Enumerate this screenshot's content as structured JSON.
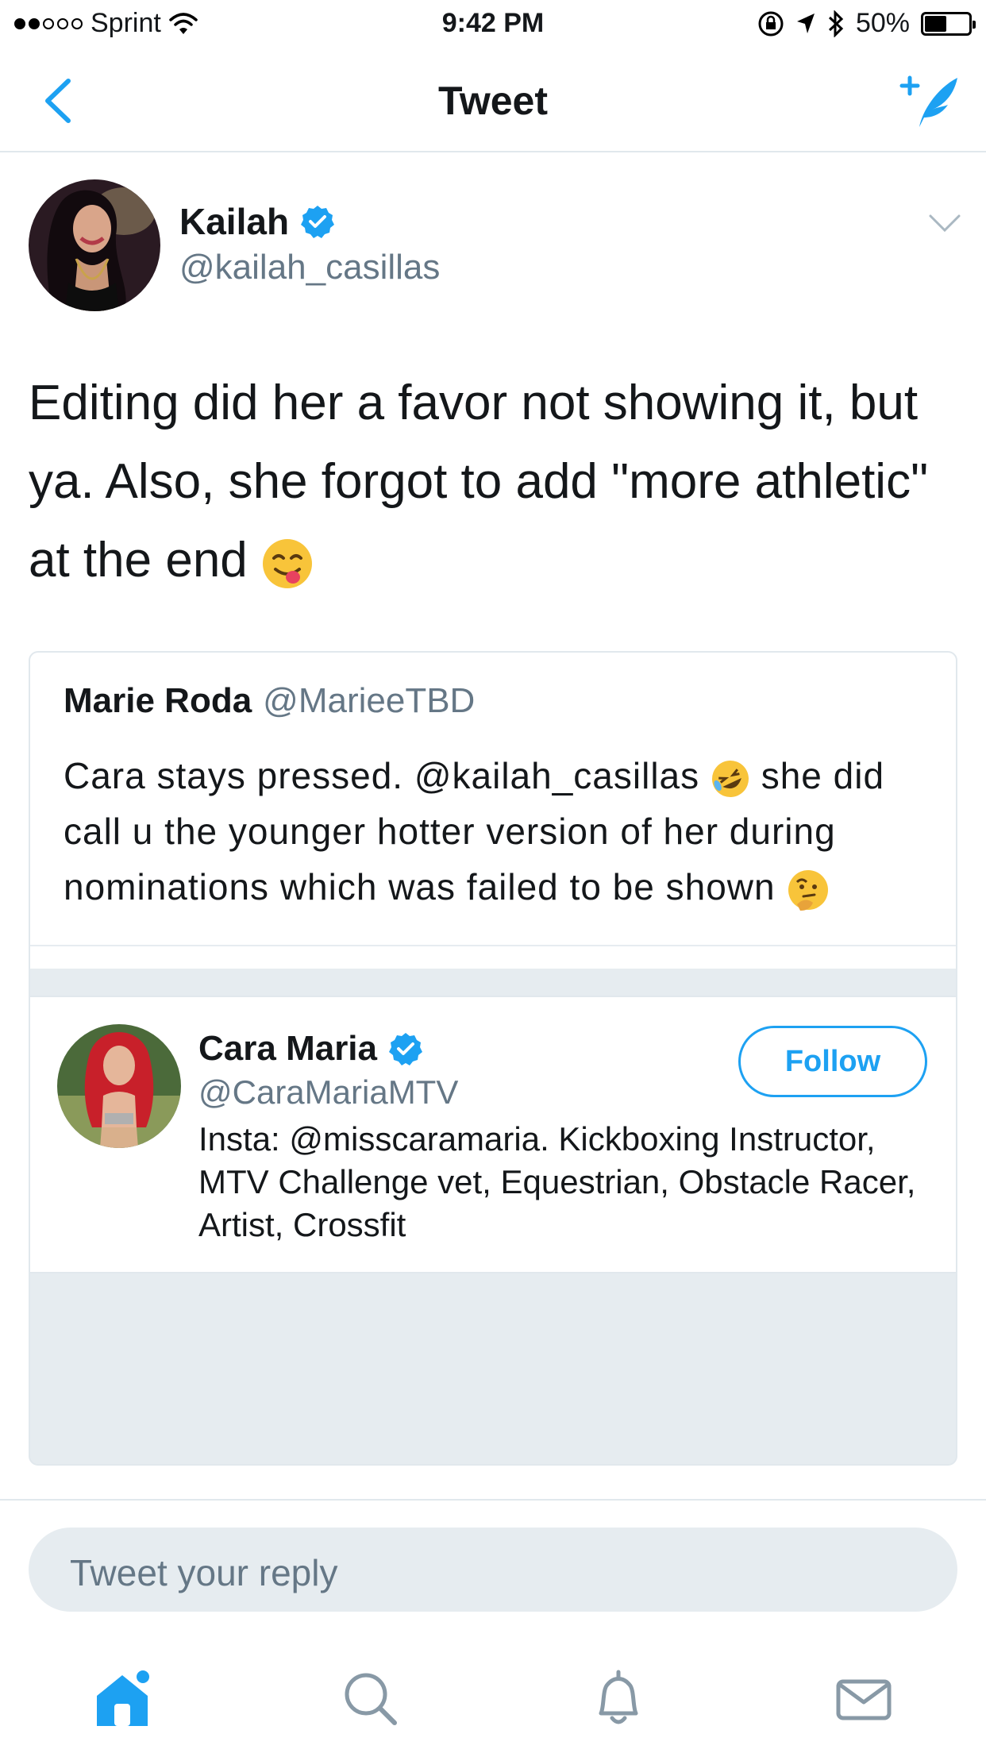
{
  "status_bar": {
    "carrier": "Sprint",
    "time": "9:42 PM",
    "battery": "50%",
    "battery_level": 0.5,
    "signal_bars": 2
  },
  "nav": {
    "title": "Tweet",
    "back_icon": "chevron-left-icon",
    "compose_icon": "compose-tweet-icon"
  },
  "tweet": {
    "author_name": "Kailah",
    "author_handle": "@kailah_casillas",
    "text": "Editing did her a favor not showing it, but ya. Also, she forgot to add \"more athletic\" at the end"
  },
  "quoted_tweet": {
    "author_name": "Marie Roda",
    "author_handle": "@MarieeTBD",
    "text_part1": "Cara stays pressed. @kailah_casillas",
    "text_part2": " she did call u the younger hotter version of her during nominations which was failed to be shown"
  },
  "profile_card": {
    "name": "Cara Maria",
    "handle": "@CaraMariaMTV",
    "bio": "Insta: @misscaramaria. Kickboxing Instructor, MTV Challenge vet, Equestrian, Obstacle Racer, Artist, Crossfit",
    "follow_label": "Follow"
  },
  "reply": {
    "placeholder": "Tweet your reply"
  },
  "tab_bar": {
    "items": [
      "home-icon",
      "search-icon",
      "notifications-icon",
      "messages-icon"
    ]
  },
  "colors": {
    "accent": "#1da1f2",
    "secondary_text": "#657786",
    "border": "#e1e8ed",
    "gray_fill": "#e6ecf0"
  }
}
